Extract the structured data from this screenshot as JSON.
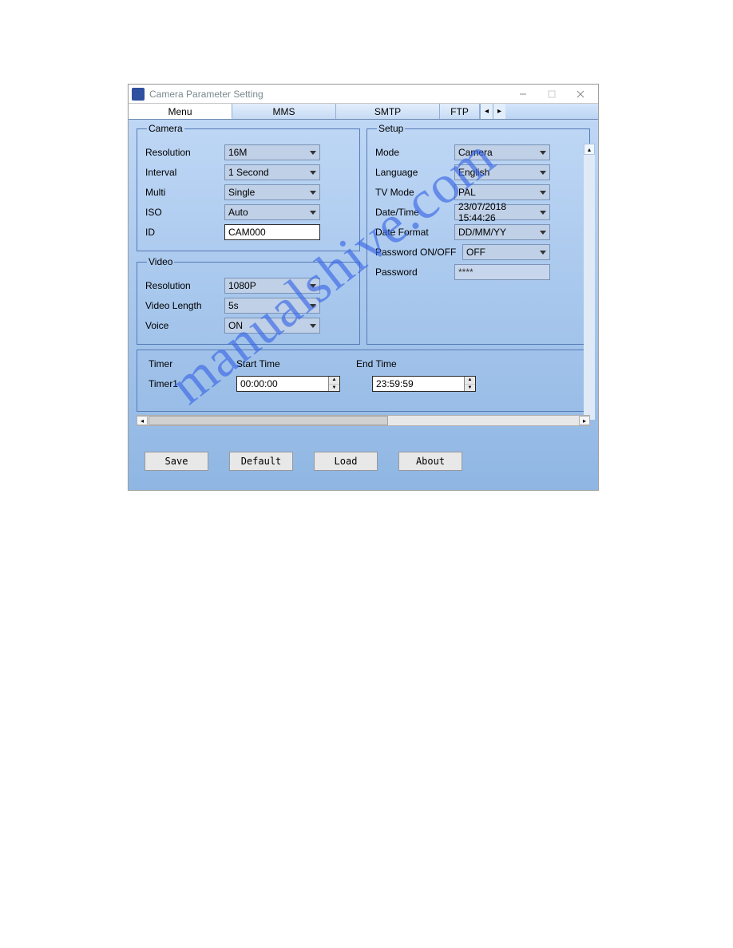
{
  "window": {
    "title": "Camera Parameter Setting"
  },
  "tabs": {
    "menu": "Menu",
    "mms": "MMS",
    "smtp": "SMTP",
    "ftp": "FTP"
  },
  "camera": {
    "legend": "Camera",
    "resolution_label": "Resolution",
    "resolution_value": "16M",
    "interval_label": "Interval",
    "interval_value": "1 Second",
    "multi_label": "Multi",
    "multi_value": "Single",
    "iso_label": "ISO",
    "iso_value": "Auto",
    "id_label": "ID",
    "id_value": "CAM000"
  },
  "video": {
    "legend": "Video",
    "resolution_label": "Resolution",
    "resolution_value": "1080P",
    "length_label": "Video Length",
    "length_value": "5s",
    "voice_label": "Voice",
    "voice_value": "ON"
  },
  "setup": {
    "legend": "Setup",
    "mode_label": "Mode",
    "mode_value": "Camera",
    "language_label": "Language",
    "language_value": "English",
    "tvmode_label": "TV Mode",
    "tvmode_value": "PAL",
    "datetime_label": "Date/Time",
    "datetime_value": "23/07/2018 15:44:26",
    "dateformat_label": "Date Format",
    "dateformat_value": "DD/MM/YY",
    "pwdonoff_label": "Password ON/OFF",
    "pwdonoff_value": "OFF",
    "pwd_label": "Password",
    "pwd_value": "****"
  },
  "timer": {
    "label": "Timer",
    "start_label": "Start Time",
    "end_label": "End Time",
    "timer1_label": "Timer1",
    "start_value": "00:00:00",
    "end_value": "23:59:59"
  },
  "buttons": {
    "save": "Save",
    "default": "Default",
    "load": "Load",
    "about": "About"
  },
  "watermark": "manualshive.com"
}
